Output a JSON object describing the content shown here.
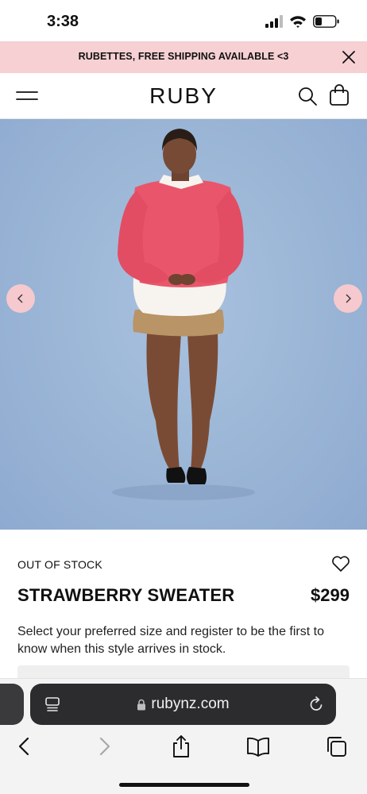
{
  "status_bar": {
    "time": "3:38"
  },
  "promo": {
    "text": "RUBETTES, FREE SHIPPING AVAILABLE <3"
  },
  "header": {
    "logo": "RUBY"
  },
  "product": {
    "stock_status": "OUT OF STOCK",
    "name": "STRAWBERRY SWEATER",
    "price": "$299",
    "description": "Select your preferred size and register to be the first to know when this style arrives in stock."
  },
  "browser": {
    "url": "rubynz.com"
  },
  "icons": {
    "signal": "cellular-signal-icon",
    "wifi": "wifi-icon",
    "battery": "battery-icon",
    "close": "close-icon",
    "menu": "hamburger-menu-icon",
    "search": "search-icon",
    "cart": "shopping-bag-icon",
    "wishlist": "heart-icon",
    "prev": "chevron-left-icon",
    "next": "chevron-right-icon",
    "page_menu": "page-menu-icon",
    "lock": "lock-icon",
    "reload": "reload-icon",
    "back": "back-arrow-icon",
    "forward": "forward-arrow-icon",
    "share": "share-icon",
    "bookmarks": "book-icon",
    "tabs": "tabs-icon"
  },
  "colors": {
    "promo_background": "#f6d0d3",
    "carousel_button": "#f5c9cd",
    "photo_backdrop": "#9bb6d6",
    "address_bar": "#2c2c2e"
  }
}
